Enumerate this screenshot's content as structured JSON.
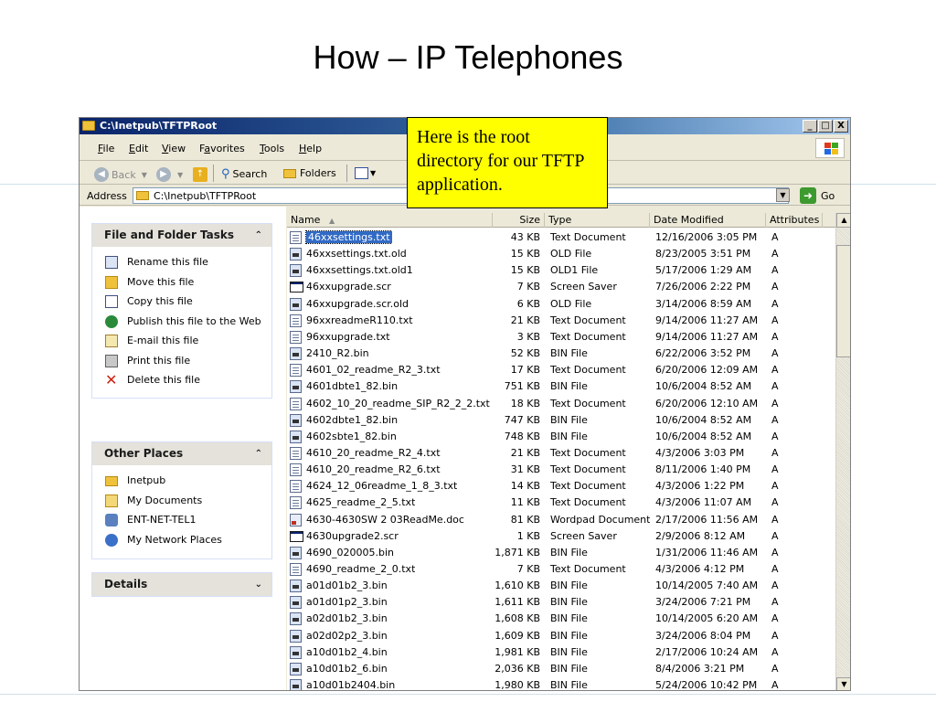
{
  "slide": {
    "title": "How – IP Telephones",
    "callout": "Here is the root directory for our TFTP application."
  },
  "window": {
    "title": "C:\\Inetpub\\TFTPRoot",
    "buttons": [
      "_",
      "□",
      "X"
    ],
    "menu": [
      "File",
      "Edit",
      "View",
      "Favorites",
      "Tools",
      "Help"
    ],
    "toolbar": {
      "back": "Back",
      "search": "Search",
      "folders": "Folders"
    },
    "address": {
      "label": "Address",
      "value": "C:\\Inetpub\\TFTPRoot",
      "go": "Go"
    }
  },
  "taskpane": {
    "file_tasks": {
      "title": "File and Folder Tasks",
      "items": [
        "Rename this file",
        "Move this file",
        "Copy this file",
        "Publish this file to the Web",
        "E-mail this file",
        "Print this file",
        "Delete this file"
      ]
    },
    "other_places": {
      "title": "Other Places",
      "items": [
        "Inetpub",
        "My Documents",
        "ENT-NET-TEL1",
        "My Network Places"
      ]
    },
    "details": {
      "title": "Details"
    }
  },
  "columns": {
    "name": "Name",
    "size": "Size",
    "type": "Type",
    "date": "Date Modified",
    "attributes": "Attributes"
  },
  "files": [
    {
      "name": "46xxsettings.txt",
      "size": "43 KB",
      "type": "Text Document",
      "date": "12/16/2006 3:05 PM",
      "attr": "A",
      "icon": "txt"
    },
    {
      "name": "46xxsettings.txt.old",
      "size": "15 KB",
      "type": "OLD File",
      "date": "8/23/2005 3:51 PM",
      "attr": "A",
      "icon": "bin"
    },
    {
      "name": "46xxsettings.txt.old1",
      "size": "15 KB",
      "type": "OLD1 File",
      "date": "5/17/2006 1:29 AM",
      "attr": "A",
      "icon": "bin"
    },
    {
      "name": "46xxupgrade.scr",
      "size": "7 KB",
      "type": "Screen Saver",
      "date": "7/26/2006 2:22 PM",
      "attr": "A",
      "icon": "scr"
    },
    {
      "name": "46xxupgrade.scr.old",
      "size": "6 KB",
      "type": "OLD File",
      "date": "3/14/2006 8:59 AM",
      "attr": "A",
      "icon": "bin"
    },
    {
      "name": "96xxreadmeR110.txt",
      "size": "21 KB",
      "type": "Text Document",
      "date": "9/14/2006 11:27 AM",
      "attr": "A",
      "icon": "txt"
    },
    {
      "name": "96xxupgrade.txt",
      "size": "3 KB",
      "type": "Text Document",
      "date": "9/14/2006 11:27 AM",
      "attr": "A",
      "icon": "txt"
    },
    {
      "name": "2410_R2.bin",
      "size": "52 KB",
      "type": "BIN File",
      "date": "6/22/2006 3:52 PM",
      "attr": "A",
      "icon": "bin"
    },
    {
      "name": "4601_02_readme_R2_3.txt",
      "size": "17 KB",
      "type": "Text Document",
      "date": "6/20/2006 12:09 AM",
      "attr": "A",
      "icon": "txt"
    },
    {
      "name": "4601dbte1_82.bin",
      "size": "751 KB",
      "type": "BIN File",
      "date": "10/6/2004 8:52 AM",
      "attr": "A",
      "icon": "bin"
    },
    {
      "name": "4602_10_20_readme_SIP_R2_2_2.txt",
      "size": "18 KB",
      "type": "Text Document",
      "date": "6/20/2006 12:10 AM",
      "attr": "A",
      "icon": "txt"
    },
    {
      "name": "4602dbte1_82.bin",
      "size": "747 KB",
      "type": "BIN File",
      "date": "10/6/2004 8:52 AM",
      "attr": "A",
      "icon": "bin"
    },
    {
      "name": "4602sbte1_82.bin",
      "size": "748 KB",
      "type": "BIN File",
      "date": "10/6/2004 8:52 AM",
      "attr": "A",
      "icon": "bin"
    },
    {
      "name": "4610_20_readme_R2_4.txt",
      "size": "21 KB",
      "type": "Text Document",
      "date": "4/3/2006 3:03 PM",
      "attr": "A",
      "icon": "txt"
    },
    {
      "name": "4610_20_readme_R2_6.txt",
      "size": "31 KB",
      "type": "Text Document",
      "date": "8/11/2006 1:40 PM",
      "attr": "A",
      "icon": "txt"
    },
    {
      "name": "4624_12_06readme_1_8_3.txt",
      "size": "14 KB",
      "type": "Text Document",
      "date": "4/3/2006 1:22 PM",
      "attr": "A",
      "icon": "txt"
    },
    {
      "name": "4625_readme_2_5.txt",
      "size": "11 KB",
      "type": "Text Document",
      "date": "4/3/2006 11:07 AM",
      "attr": "A",
      "icon": "txt"
    },
    {
      "name": "4630-4630SW 2 03ReadMe.doc",
      "size": "81 KB",
      "type": "Wordpad Document",
      "date": "2/17/2006 11:56 AM",
      "attr": "A",
      "icon": "doc"
    },
    {
      "name": "4630upgrade2.scr",
      "size": "1 KB",
      "type": "Screen Saver",
      "date": "2/9/2006 8:12 AM",
      "attr": "A",
      "icon": "scr"
    },
    {
      "name": "4690_020005.bin",
      "size": "1,871 KB",
      "type": "BIN File",
      "date": "1/31/2006 11:46 AM",
      "attr": "A",
      "icon": "bin"
    },
    {
      "name": "4690_readme_2_0.txt",
      "size": "7 KB",
      "type": "Text Document",
      "date": "4/3/2006 4:12 PM",
      "attr": "A",
      "icon": "txt"
    },
    {
      "name": "a01d01b2_3.bin",
      "size": "1,610 KB",
      "type": "BIN File",
      "date": "10/14/2005 7:40 AM",
      "attr": "A",
      "icon": "bin"
    },
    {
      "name": "a01d01p2_3.bin",
      "size": "1,611 KB",
      "type": "BIN File",
      "date": "3/24/2006 7:21 PM",
      "attr": "A",
      "icon": "bin"
    },
    {
      "name": "a02d01b2_3.bin",
      "size": "1,608 KB",
      "type": "BIN File",
      "date": "10/14/2005 6:20 AM",
      "attr": "A",
      "icon": "bin"
    },
    {
      "name": "a02d02p2_3.bin",
      "size": "1,609 KB",
      "type": "BIN File",
      "date": "3/24/2006 8:04 PM",
      "attr": "A",
      "icon": "bin"
    },
    {
      "name": "a10d01b2_4.bin",
      "size": "1,981 KB",
      "type": "BIN File",
      "date": "2/17/2006 10:24 AM",
      "attr": "A",
      "icon": "bin"
    },
    {
      "name": "a10d01b2_6.bin",
      "size": "2,036 KB",
      "type": "BIN File",
      "date": "8/4/2006 3:21 PM",
      "attr": "A",
      "icon": "bin"
    },
    {
      "name": "a10d01b2404.bin",
      "size": "1,980 KB",
      "type": "BIN File",
      "date": "5/24/2006 10:42 PM",
      "attr": "A",
      "icon": "bin"
    }
  ],
  "selected_file": "46xxsettings.txt"
}
